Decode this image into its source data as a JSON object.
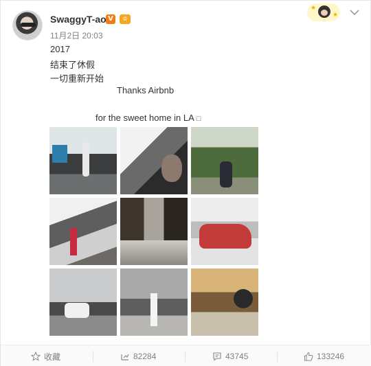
{
  "post": {
    "username": "SwaggyT-ao",
    "verified_badge": "V",
    "member_badge": "♔",
    "timestamp": "11月2日 20:03",
    "lines": [
      "2017",
      "结束了休假",
      "一切重新开始",
      "Thanks Airbnb",
      "for the sweet home in LA ",
      "□"
    ]
  },
  "images": [
    {
      "alt": "living room"
    },
    {
      "alt": "window selfie"
    },
    {
      "alt": "garden"
    },
    {
      "alt": "staircase"
    },
    {
      "alt": "hallway"
    },
    {
      "alt": "red car"
    },
    {
      "alt": "street"
    },
    {
      "alt": "sidewalk"
    },
    {
      "alt": "restaurant"
    }
  ],
  "footer": {
    "favorite_label": "收藏",
    "repost_count": "82284",
    "comment_count": "43745",
    "like_count": "133246"
  },
  "colors": {
    "verified": "#f57c13",
    "text": "#333333",
    "muted": "#808080"
  },
  "icons": [
    "star-icon",
    "repost-icon",
    "comment-icon",
    "thumbs-up-icon",
    "chevron-down-icon"
  ]
}
